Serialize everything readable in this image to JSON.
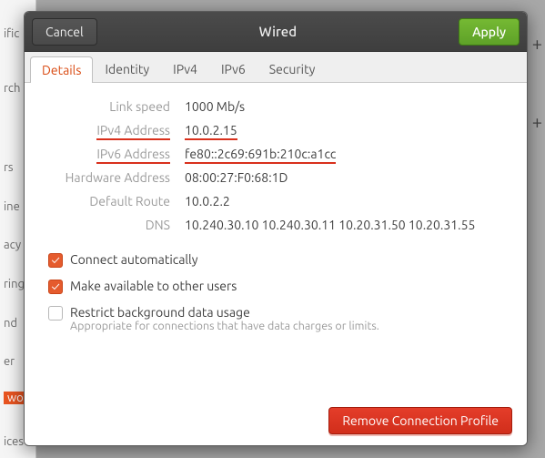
{
  "bg": {
    "rows": [
      "ific",
      "rch",
      "",
      "rs",
      "ine",
      "acy",
      "ring",
      "nd",
      "er",
      "wo",
      "ices"
    ]
  },
  "titlebar": {
    "cancel": "Cancel",
    "title": "Wired",
    "apply": "Apply"
  },
  "tabs": [
    {
      "label": "Details",
      "active": true
    },
    {
      "label": "Identity",
      "active": false
    },
    {
      "label": "IPv4",
      "active": false
    },
    {
      "label": "IPv6",
      "active": false
    },
    {
      "label": "Security",
      "active": false
    }
  ],
  "details": {
    "link_speed": {
      "label": "Link speed",
      "value": "1000 Mb/s"
    },
    "ipv4": {
      "label": "IPv4 Address",
      "value": "10.0.2.15"
    },
    "ipv6": {
      "label": "IPv6 Address",
      "value": "fe80::2c69:691b:210c:a1cc"
    },
    "hw": {
      "label": "Hardware Address",
      "value": "08:00:27:F0:68:1D"
    },
    "default_route": {
      "label": "Default Route",
      "value": "10.0.2.2"
    },
    "dns": {
      "label": "DNS",
      "value": "10.240.30.10 10.240.30.11 10.20.31.50 10.20.31.55"
    }
  },
  "checks": {
    "auto": {
      "label": "Connect automatically",
      "checked": true
    },
    "share": {
      "label": "Make available to other users",
      "checked": true
    },
    "restrict": {
      "label": "Restrict background data usage",
      "sub": "Appropriate for connections that have data charges or limits.",
      "checked": false
    }
  },
  "footer": {
    "remove": "Remove Connection Profile"
  }
}
